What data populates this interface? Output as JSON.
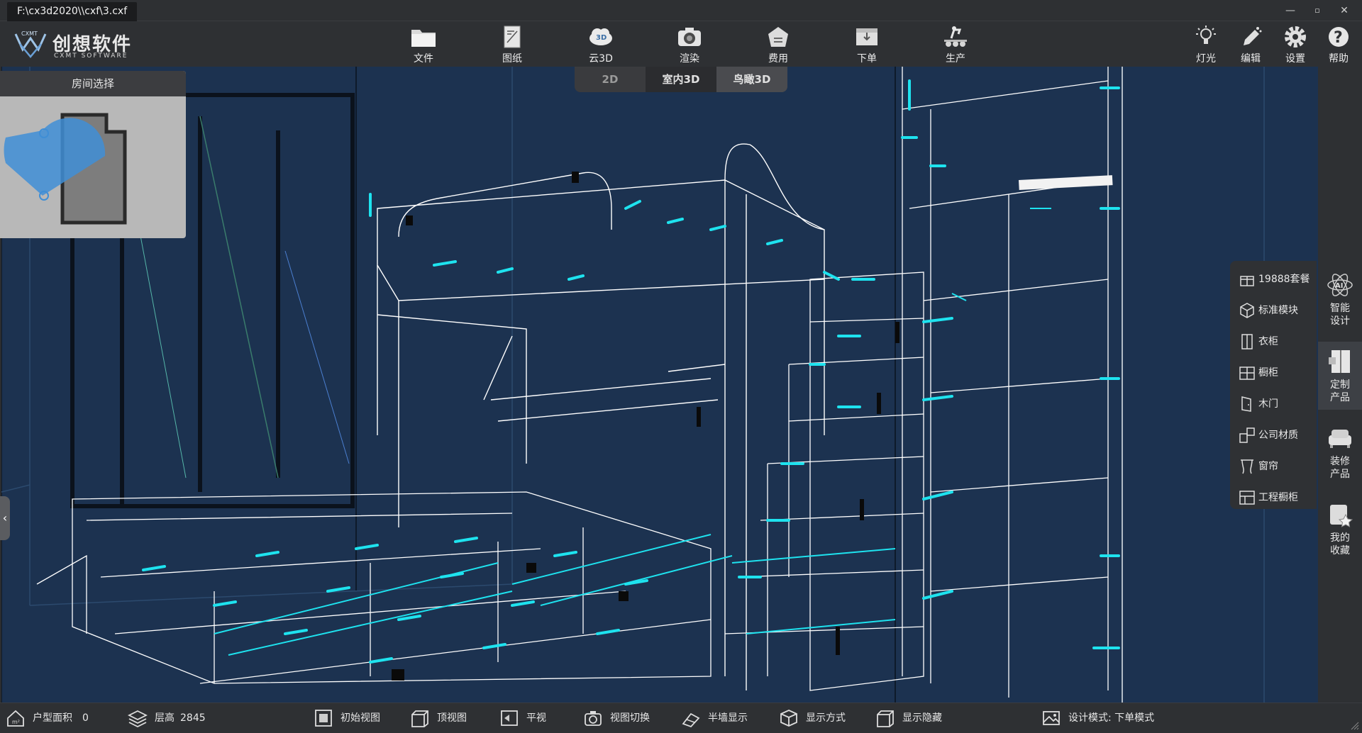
{
  "window": {
    "file_tab": "F:\\cx3d2020\\\\cxf\\3.cxf"
  },
  "logo": {
    "cn": "创想软件",
    "en": "CXMT SOFTWARE"
  },
  "toolbar": {
    "items": [
      {
        "label": "文件",
        "icon": "folder-icon"
      },
      {
        "label": "图纸",
        "icon": "drawing-icon"
      },
      {
        "label": "云3D",
        "icon": "cloud-3d-icon"
      },
      {
        "label": "渲染",
        "icon": "camera-icon"
      },
      {
        "label": "费用",
        "icon": "cost-icon"
      },
      {
        "label": "下单",
        "icon": "order-icon"
      },
      {
        "label": "生产",
        "icon": "production-icon"
      }
    ],
    "right": [
      {
        "label": "灯光",
        "icon": "light-icon"
      },
      {
        "label": "编辑",
        "icon": "edit-icon"
      },
      {
        "label": "设置",
        "icon": "gear-icon"
      },
      {
        "label": "帮助",
        "icon": "help-icon"
      }
    ]
  },
  "view_tabs": {
    "tab_2d": "2D",
    "tab_indoor": "室内3D",
    "tab_bird": "鸟瞰3D",
    "active": "鸟瞰3D"
  },
  "room_selector": {
    "title": "房间选择"
  },
  "catalog": {
    "items": [
      {
        "label": "19888套餐",
        "icon": "gift-icon"
      },
      {
        "label": "标准模块",
        "icon": "cube-icon"
      },
      {
        "label": "衣柜",
        "icon": "wardrobe-icon"
      },
      {
        "label": "橱柜",
        "icon": "cabinet-icon"
      },
      {
        "label": "木门",
        "icon": "door-icon"
      },
      {
        "label": "公司材质",
        "icon": "material-icon"
      },
      {
        "label": "窗帘",
        "icon": "curtain-icon"
      },
      {
        "label": "工程橱柜",
        "icon": "project-cabinet-icon"
      }
    ]
  },
  "rail": {
    "items": [
      {
        "line1": "智能",
        "line2": "设计",
        "icon": "ai-icon"
      },
      {
        "line1": "定制",
        "line2": "产品",
        "icon": "custom-product-icon"
      },
      {
        "line1": "装修",
        "line2": "产品",
        "icon": "sofa-icon"
      },
      {
        "line1": "我的",
        "line2": "收藏",
        "icon": "favorite-icon"
      }
    ]
  },
  "status": {
    "area_label": "户型面积",
    "area_value": "0",
    "height_label": "层高",
    "height_value": "2845",
    "initial_view": "初始视图",
    "top_view": "顶视图",
    "flat_view": "平视",
    "view_switch": "视图切换",
    "half_wall": "半墙显示",
    "display_mode": "显示方式",
    "display_hide": "显示隐藏",
    "design_mode": "设计模式: 下单模式"
  },
  "colors": {
    "viewport_bg": "#1c3250",
    "wire": "#ffffff",
    "accent": "#1ee3ef"
  }
}
